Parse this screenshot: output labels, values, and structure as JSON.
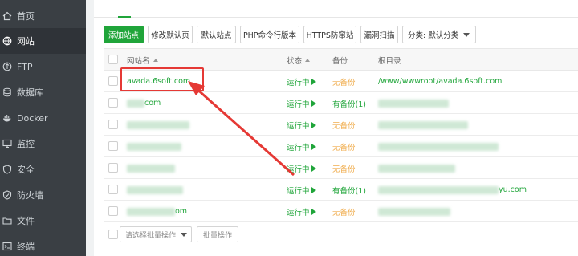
{
  "sidebar": {
    "items": [
      {
        "label": "首页",
        "icon": "home-icon"
      },
      {
        "label": "网站",
        "icon": "globe-icon"
      },
      {
        "label": "FTP",
        "icon": "ftp-icon"
      },
      {
        "label": "数据库",
        "icon": "database-icon"
      },
      {
        "label": "Docker",
        "icon": "docker-icon"
      },
      {
        "label": "监控",
        "icon": "monitor-icon"
      },
      {
        "label": "安全",
        "icon": "shield-icon"
      },
      {
        "label": "防火墙",
        "icon": "firewall-icon"
      },
      {
        "label": "文件",
        "icon": "folder-icon"
      },
      {
        "label": "终端",
        "icon": "terminal-icon"
      }
    ],
    "active_index": 1
  },
  "toolbar": {
    "add_site": "添加站点",
    "edit_default_page": "修改默认页",
    "default_site": "默认站点",
    "php_cli_version": "PHP命令行版本",
    "https_firewall": "HTTPS防窜站",
    "vuln_scan": "漏洞扫描",
    "category_select": "分类: 默认分类"
  },
  "table": {
    "headers": {
      "site_name": "网站名",
      "status": "状态",
      "backup": "备份",
      "root_dir": "根目录"
    },
    "rows": [
      {
        "site": "avada.6soft.com",
        "status": "运行中",
        "backup": "无备份",
        "backup_state": "none",
        "root": "/www/wwwroot/avada.6soft.com"
      },
      {
        "site": "com",
        "status": "运行中",
        "backup": "有备份(1)",
        "backup_state": "has",
        "root": ""
      },
      {
        "site": "",
        "status": "运行中",
        "backup": "无备份",
        "backup_state": "none",
        "root": ""
      },
      {
        "site": "",
        "status": "运行中",
        "backup": "无备份",
        "backup_state": "none",
        "root": ""
      },
      {
        "site": "",
        "status": "运行中",
        "backup": "无备份",
        "backup_state": "none",
        "root": ""
      },
      {
        "site": "",
        "status": "运行中",
        "backup": "有备份(1)",
        "backup_state": "has",
        "root": "yu.com"
      },
      {
        "site": "om",
        "status": "运行中",
        "backup": "无备份",
        "backup_state": "none",
        "root": ""
      }
    ]
  },
  "footer": {
    "batch_placeholder": "请选择批量操作",
    "batch_button": "批量操作"
  },
  "colors": {
    "accent": "#20a53a",
    "warning": "#f0ad4e",
    "highlight": "#e53935",
    "sidebar_bg": "#3a3f44"
  }
}
